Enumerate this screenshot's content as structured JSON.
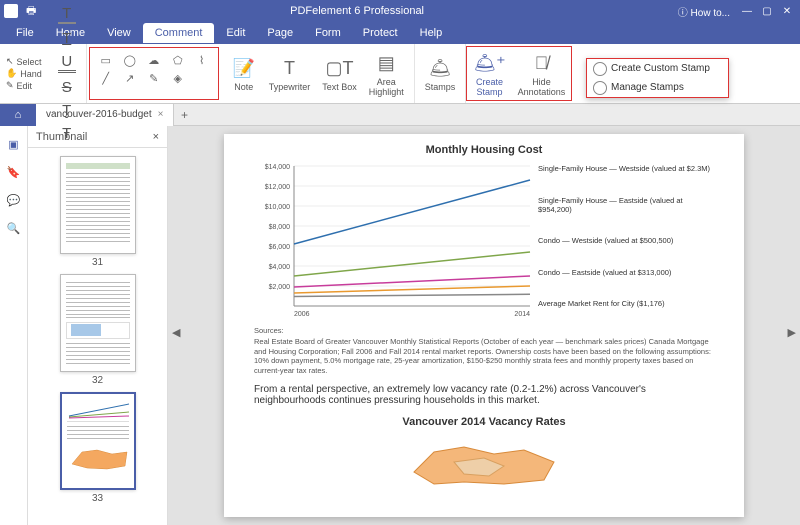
{
  "app_title": "PDFelement 6 Professional",
  "howto": "How to...",
  "menus": [
    "File",
    "Home",
    "View",
    "Comment",
    "Edit",
    "Page",
    "Form",
    "Protect",
    "Help"
  ],
  "active_menu": "Comment",
  "selection": {
    "select": "Select",
    "hand": "Hand",
    "edit": "Edit"
  },
  "text_tools": [
    "T",
    "T",
    "U",
    "S",
    "T",
    "T"
  ],
  "ribbon_buttons": {
    "note": "Note",
    "typewriter": "Typewriter",
    "textbox": "Text Box",
    "area": "Area\nHighlight",
    "stamps": "Stamps",
    "create_stamp": "Create\nStamp",
    "hide": "Hide\nAnnotations"
  },
  "stamp_menu": [
    "Create Custom Stamp",
    "Manage Stamps"
  ],
  "tab": {
    "name": "vancouver-2016-budget"
  },
  "thumb_title": "Thumbnail",
  "pages": [
    31,
    32,
    33
  ],
  "selected_page": 33,
  "doc": {
    "chart_title": "Monthly Housing Cost",
    "xlabels": [
      "2006",
      "2014"
    ],
    "legend": [
      "Single-Family House — Westside (valued at $2.3M)",
      "Single-Family House — Eastside (valued at $954,200)",
      "Condo — Westside (valued at $500,500)",
      "Condo — Eastside (valued at $313,000)",
      "Average Market Rent for City ($1,176)"
    ],
    "sources_label": "Sources:",
    "sources_text": "Real Estate Board of Greater Vancouver Monthly Statistical Reports (October of each year — benchmark sales prices) Canada Mortgage and Housing Corporation; Fall 2006 and Fall 2014 rental market reports. Ownership costs have been based on the following assumptions: 10% down payment, 5.0% mortgage rate, 25-year amortization, $150-$250 monthly strata fees and monthly property taxes based on current-year tax rates.",
    "body": "From a rental perspective, an extremely low vacancy rate (0.2-1.2%) across Vancouver's neighbourhoods continues pressuring households in this market.",
    "subtitle": "Vancouver 2014 Vacancy Rates"
  },
  "chart_data": {
    "type": "line",
    "title": "Monthly Housing Cost",
    "xlabel": "",
    "ylabel": "",
    "x": [
      "2006",
      "2014"
    ],
    "ylim": [
      0,
      14000
    ],
    "yticks": [
      2000,
      4000,
      6000,
      8000,
      10000,
      12000,
      14000
    ],
    "ytick_labels": [
      "$2,000",
      "$4,000",
      "$6,000",
      "$8,000",
      "$10,000",
      "$12,000",
      "$14,000"
    ],
    "series": [
      {
        "name": "Single-Family House — Westside (valued at $2.3M)",
        "values": [
          6200,
          12600
        ],
        "color": "#2e6fae"
      },
      {
        "name": "Single-Family House — Eastside (valued at $954,200)",
        "values": [
          3000,
          5400
        ],
        "color": "#7fa64a"
      },
      {
        "name": "Condo — Westside (valued at $500,500)",
        "values": [
          1900,
          3000
        ],
        "color": "#c73c9b"
      },
      {
        "name": "Condo — Eastside (valued at $313,000)",
        "values": [
          1300,
          2000
        ],
        "color": "#e9992f"
      },
      {
        "name": "Average Market Rent for City ($1,176)",
        "values": [
          950,
          1176
        ],
        "color": "#888888"
      }
    ]
  }
}
